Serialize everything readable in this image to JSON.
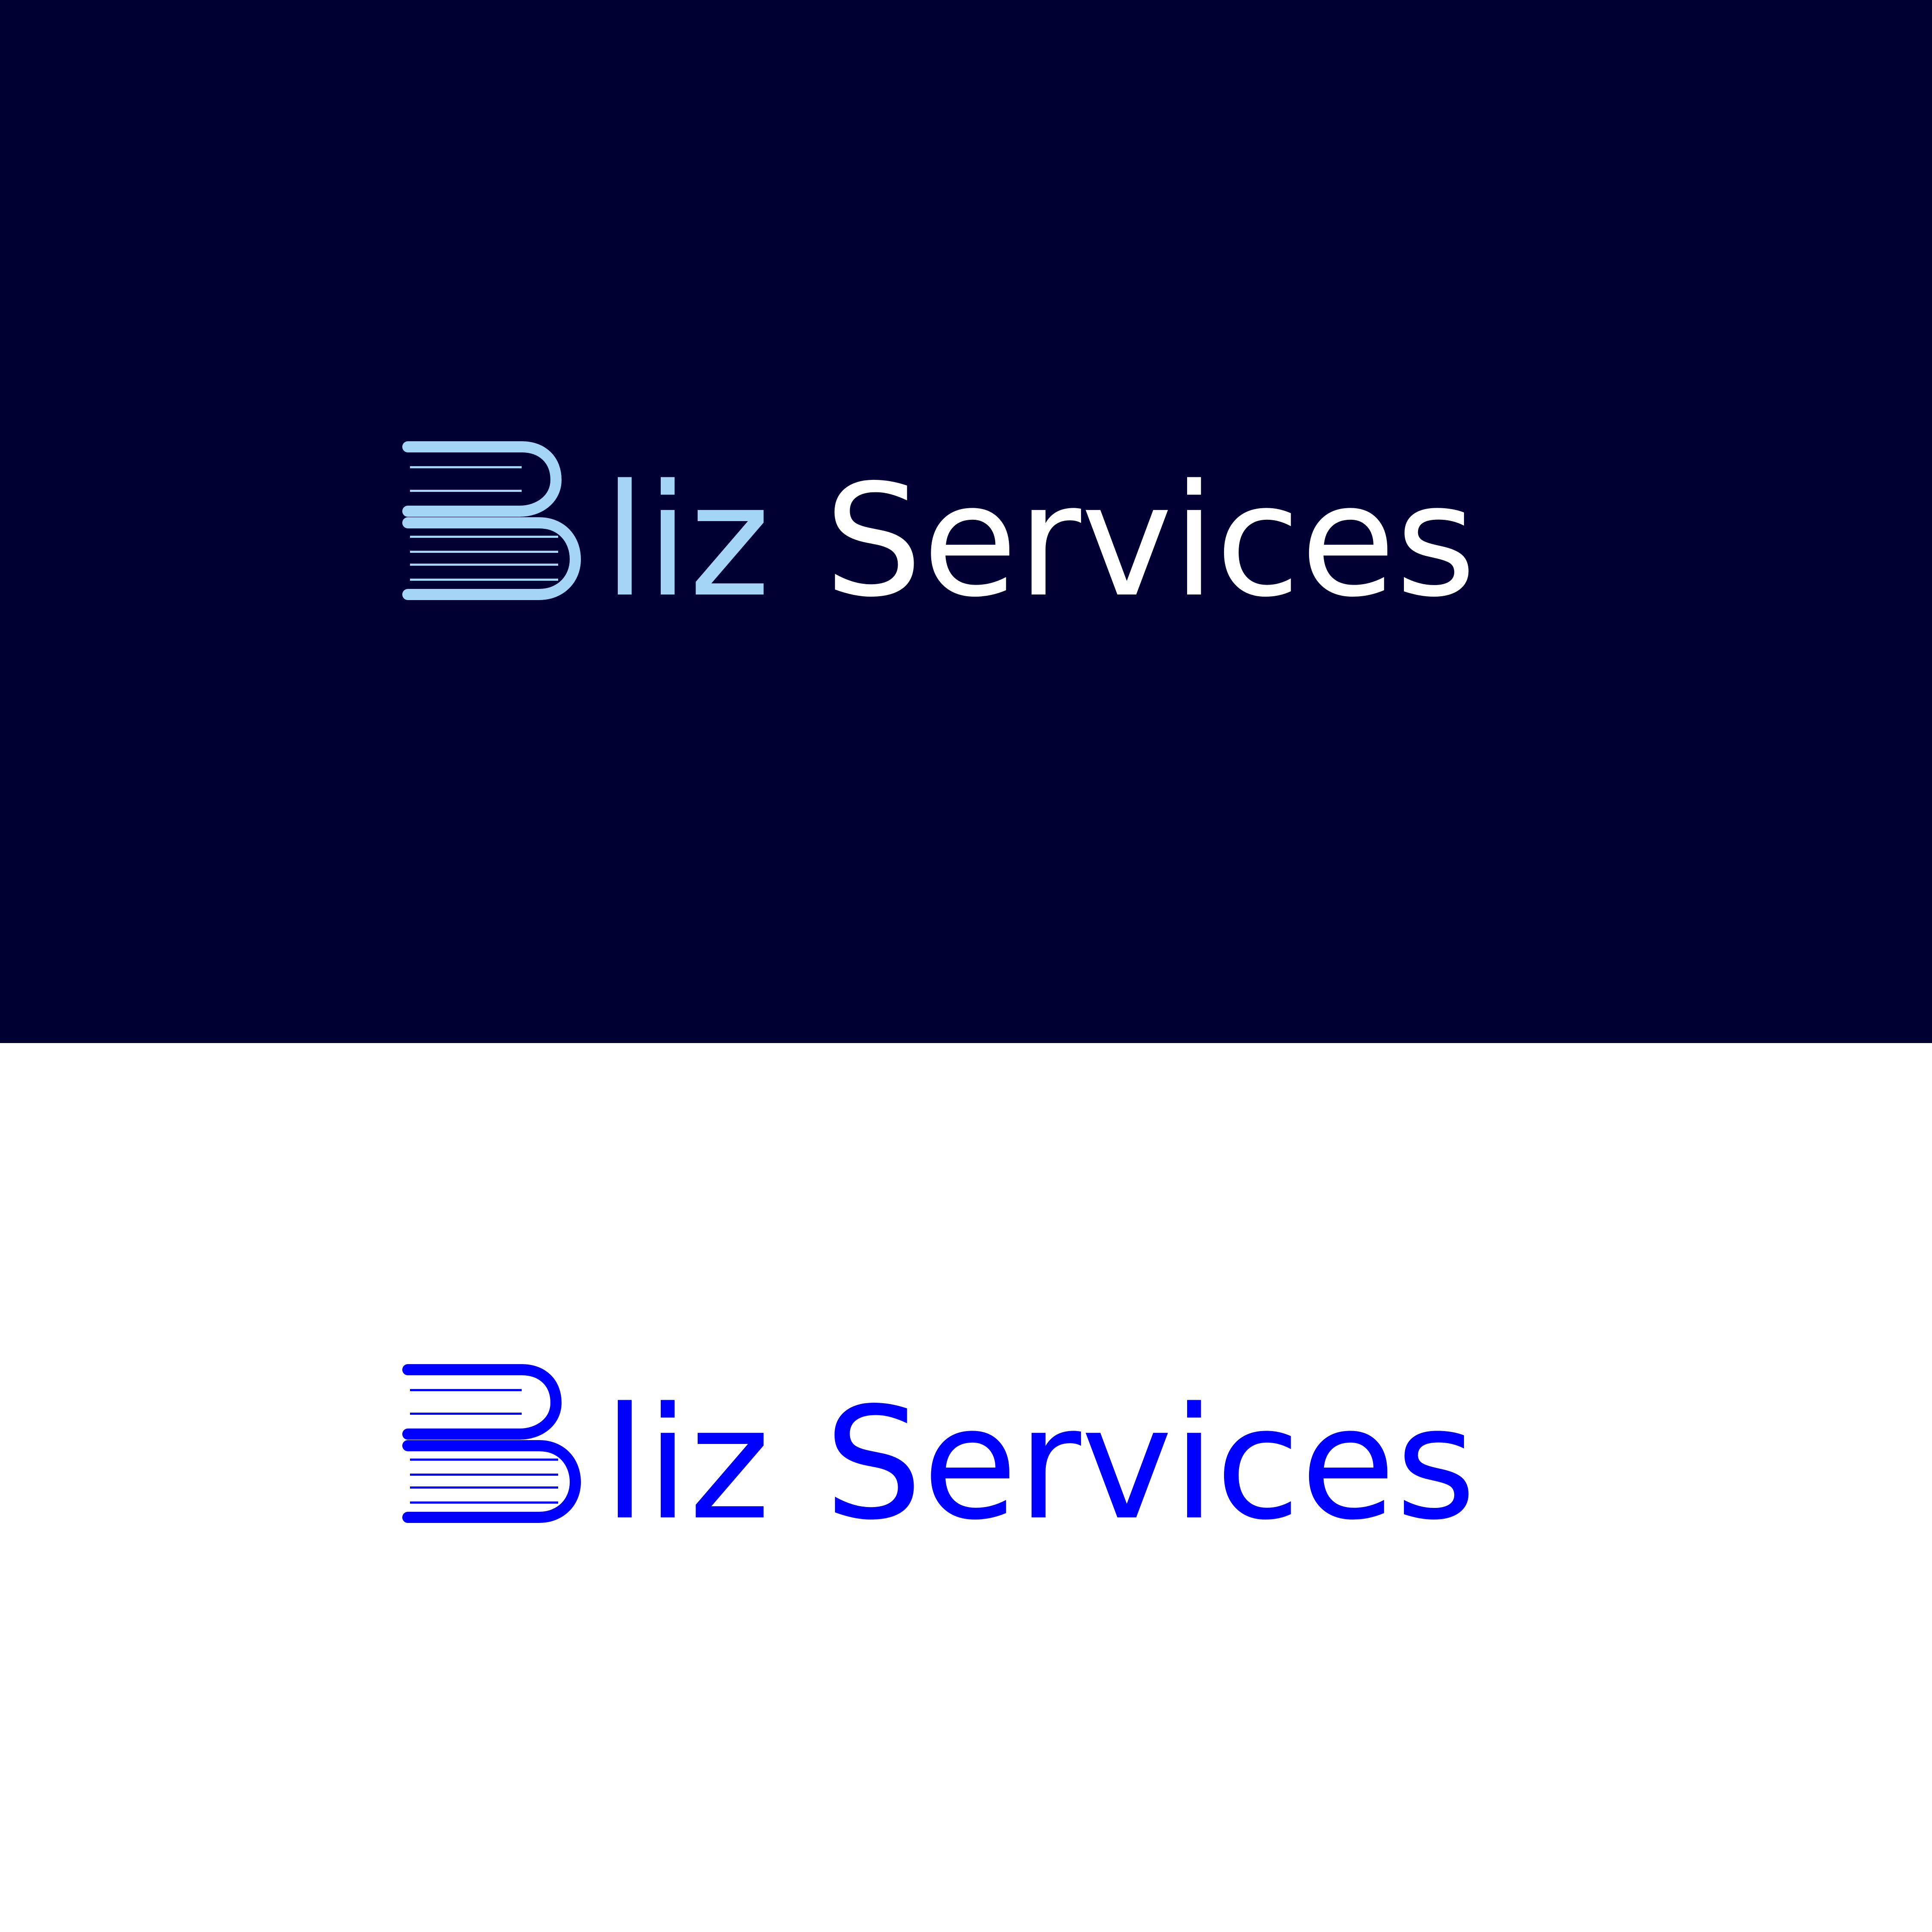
{
  "brand": {
    "prefix": "liz",
    "suffix": "Services"
  },
  "variants": [
    {
      "name": "dark",
      "background": "#000033",
      "icon_color": "#a4d4f6",
      "prefix_color": "#a4d4f6",
      "suffix_color": "#ffffff"
    },
    {
      "name": "light",
      "background": "#ffffff",
      "icon_color": "#0000ff",
      "prefix_color": "#0000ff",
      "suffix_color": "#0000ff"
    }
  ],
  "icons": {
    "mark": "book-b-icon"
  }
}
